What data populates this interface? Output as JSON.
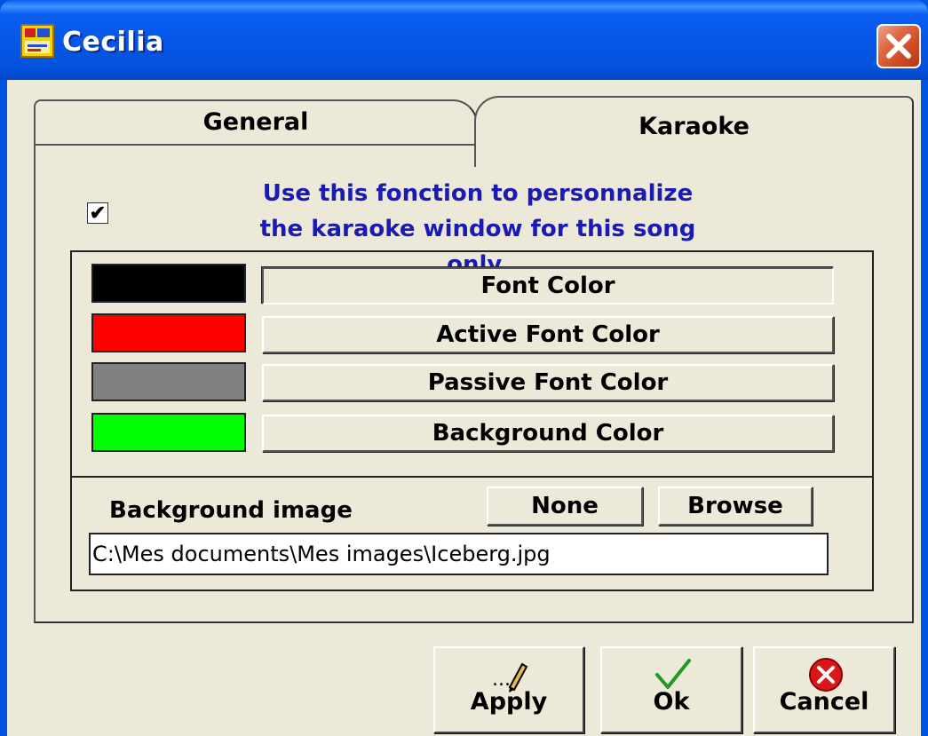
{
  "window": {
    "title": "Cecilia"
  },
  "tabs": [
    {
      "label": "General",
      "active": false
    },
    {
      "label": "Karaoke",
      "active": true
    }
  ],
  "karaoke": {
    "enable_checked": true,
    "info_line1": "Use this fonction to personnalize",
    "info_line2": "the karaoke window for this song only.",
    "colors": [
      {
        "label": "Font Color",
        "swatch": "#000000"
      },
      {
        "label": "Active Font Color",
        "swatch": "#ff0000"
      },
      {
        "label": "Passive Font Color",
        "swatch": "#808080"
      },
      {
        "label": "Background Color",
        "swatch": "#00ff00"
      }
    ],
    "background_image_label": "Background image",
    "none_label": "None",
    "browse_label": "Browse",
    "background_image_path": "C:\\Mes documents\\Mes images\\Iceberg.jpg"
  },
  "footer": {
    "apply_label": "Apply",
    "ok_label": "Ok",
    "cancel_label": "Cancel"
  },
  "icons": {
    "app": "app-icon",
    "close": "close-icon",
    "apply": "pencil-icon",
    "ok": "checkmark-icon",
    "cancel": "cancel-x-icon"
  }
}
